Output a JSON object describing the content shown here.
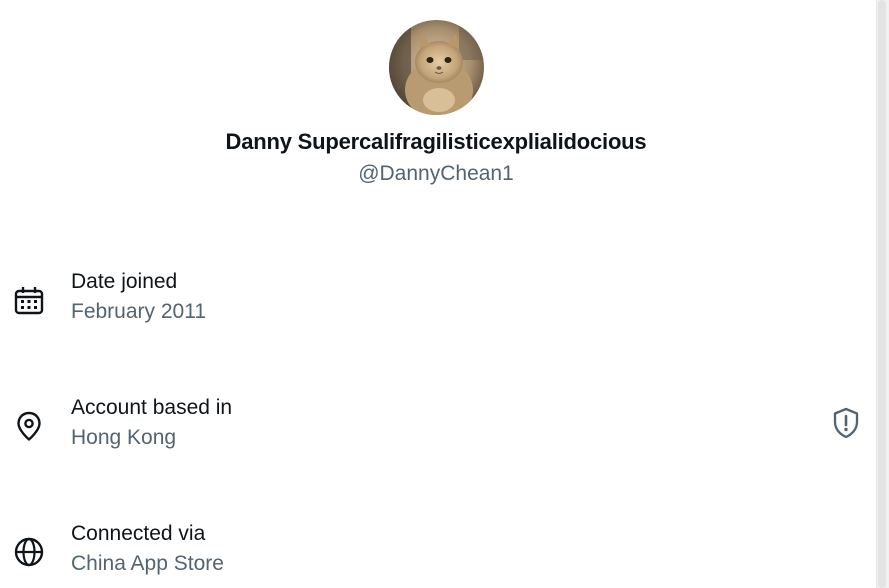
{
  "profile": {
    "display_name": "Danny Supercalifragilisticexplialidocious",
    "handle": "@DannyChean1",
    "avatar_icon": "cat-avatar"
  },
  "info": [
    {
      "label": "Date joined",
      "value": "February 2011",
      "icon": "calendar-icon"
    },
    {
      "label": "Account based in",
      "value": "Hong Kong",
      "icon": "location-pin-icon",
      "action_icon": "shield-alert-icon"
    },
    {
      "label": "Connected via",
      "value": "China App Store",
      "icon": "globe-icon"
    }
  ],
  "colors": {
    "primary_text": "#0f1419",
    "secondary_text": "#536471",
    "background": "#ffffff"
  }
}
